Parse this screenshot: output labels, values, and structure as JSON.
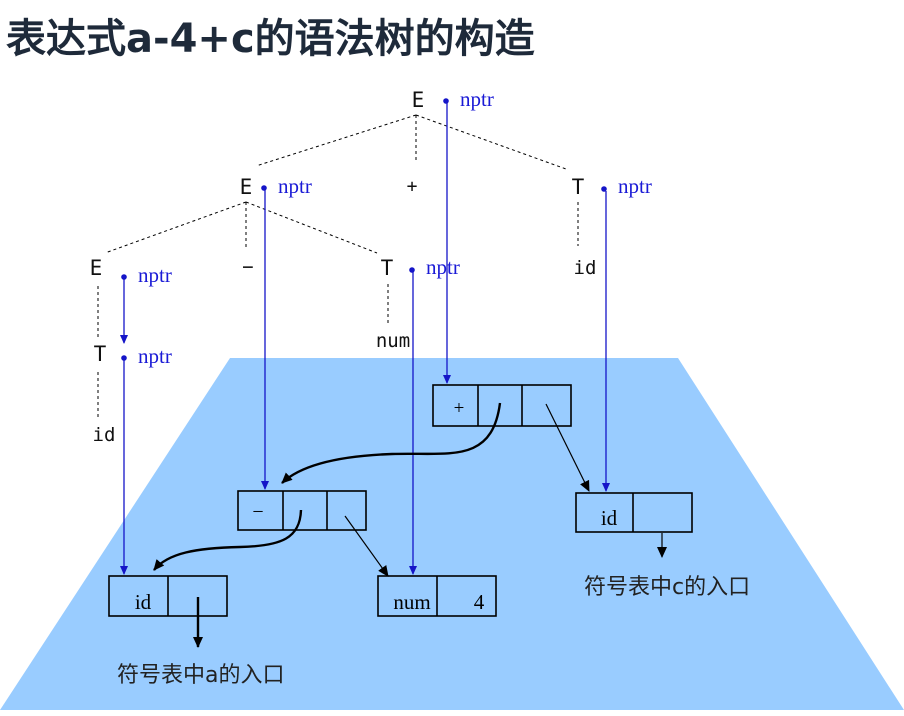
{
  "title": "表达式a-4+c的语法树的构造",
  "tree": {
    "root": {
      "symbol": "E",
      "pointer": "nptr"
    },
    "plus_symbol": "+",
    "left_e": {
      "symbol": "E",
      "pointer": "nptr"
    },
    "minus_symbol": "−",
    "right_t": {
      "symbol": "T",
      "pointer": "nptr",
      "child": "id"
    },
    "inner_e": {
      "symbol": "E",
      "pointer": "nptr"
    },
    "inner_t": {
      "symbol": "T",
      "pointer": "nptr",
      "child": "num"
    },
    "leaf_t": {
      "symbol": "T",
      "pointer": "nptr",
      "child": "id"
    }
  },
  "nodes": {
    "plus_node": {
      "op": "+"
    },
    "minus_node": {
      "op": "−"
    },
    "id_a": {
      "label": "id"
    },
    "num_node": {
      "label": "num",
      "value": "4"
    },
    "id_c": {
      "label": "id"
    }
  },
  "captions": {
    "entry_a": "符号表中a的入口",
    "entry_c": "符号表中c的入口"
  },
  "colors": {
    "trapezoid": "#99ccff",
    "pointer": "#1515c8",
    "title": "#1e2a3a"
  }
}
